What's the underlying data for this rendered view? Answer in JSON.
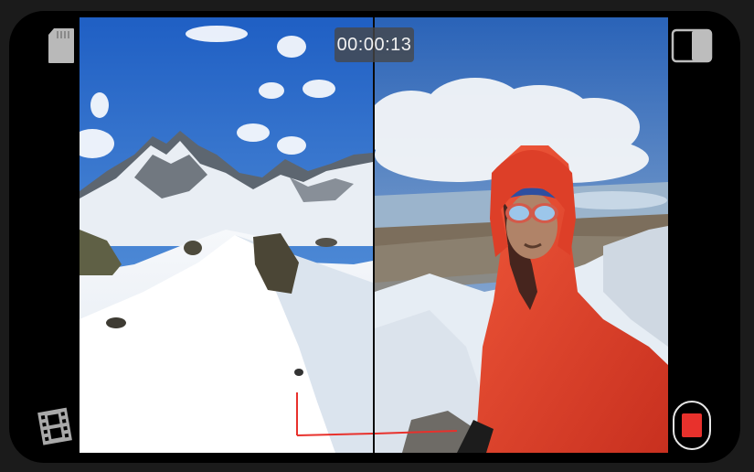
{
  "recorder": {
    "timer": "00:00:13"
  },
  "icons": {
    "storage": "sd-card-icon",
    "film": "film-strip-icon",
    "layout": "split-view-icon",
    "record": "record-stop-icon"
  },
  "colors": {
    "record_accent": "#e8312c",
    "sky": "#2f6fc6",
    "snow": "#f3f6fa",
    "jacket": "#e8452f",
    "axis_x": "#e8312c",
    "axis_y": "#e8312c"
  }
}
